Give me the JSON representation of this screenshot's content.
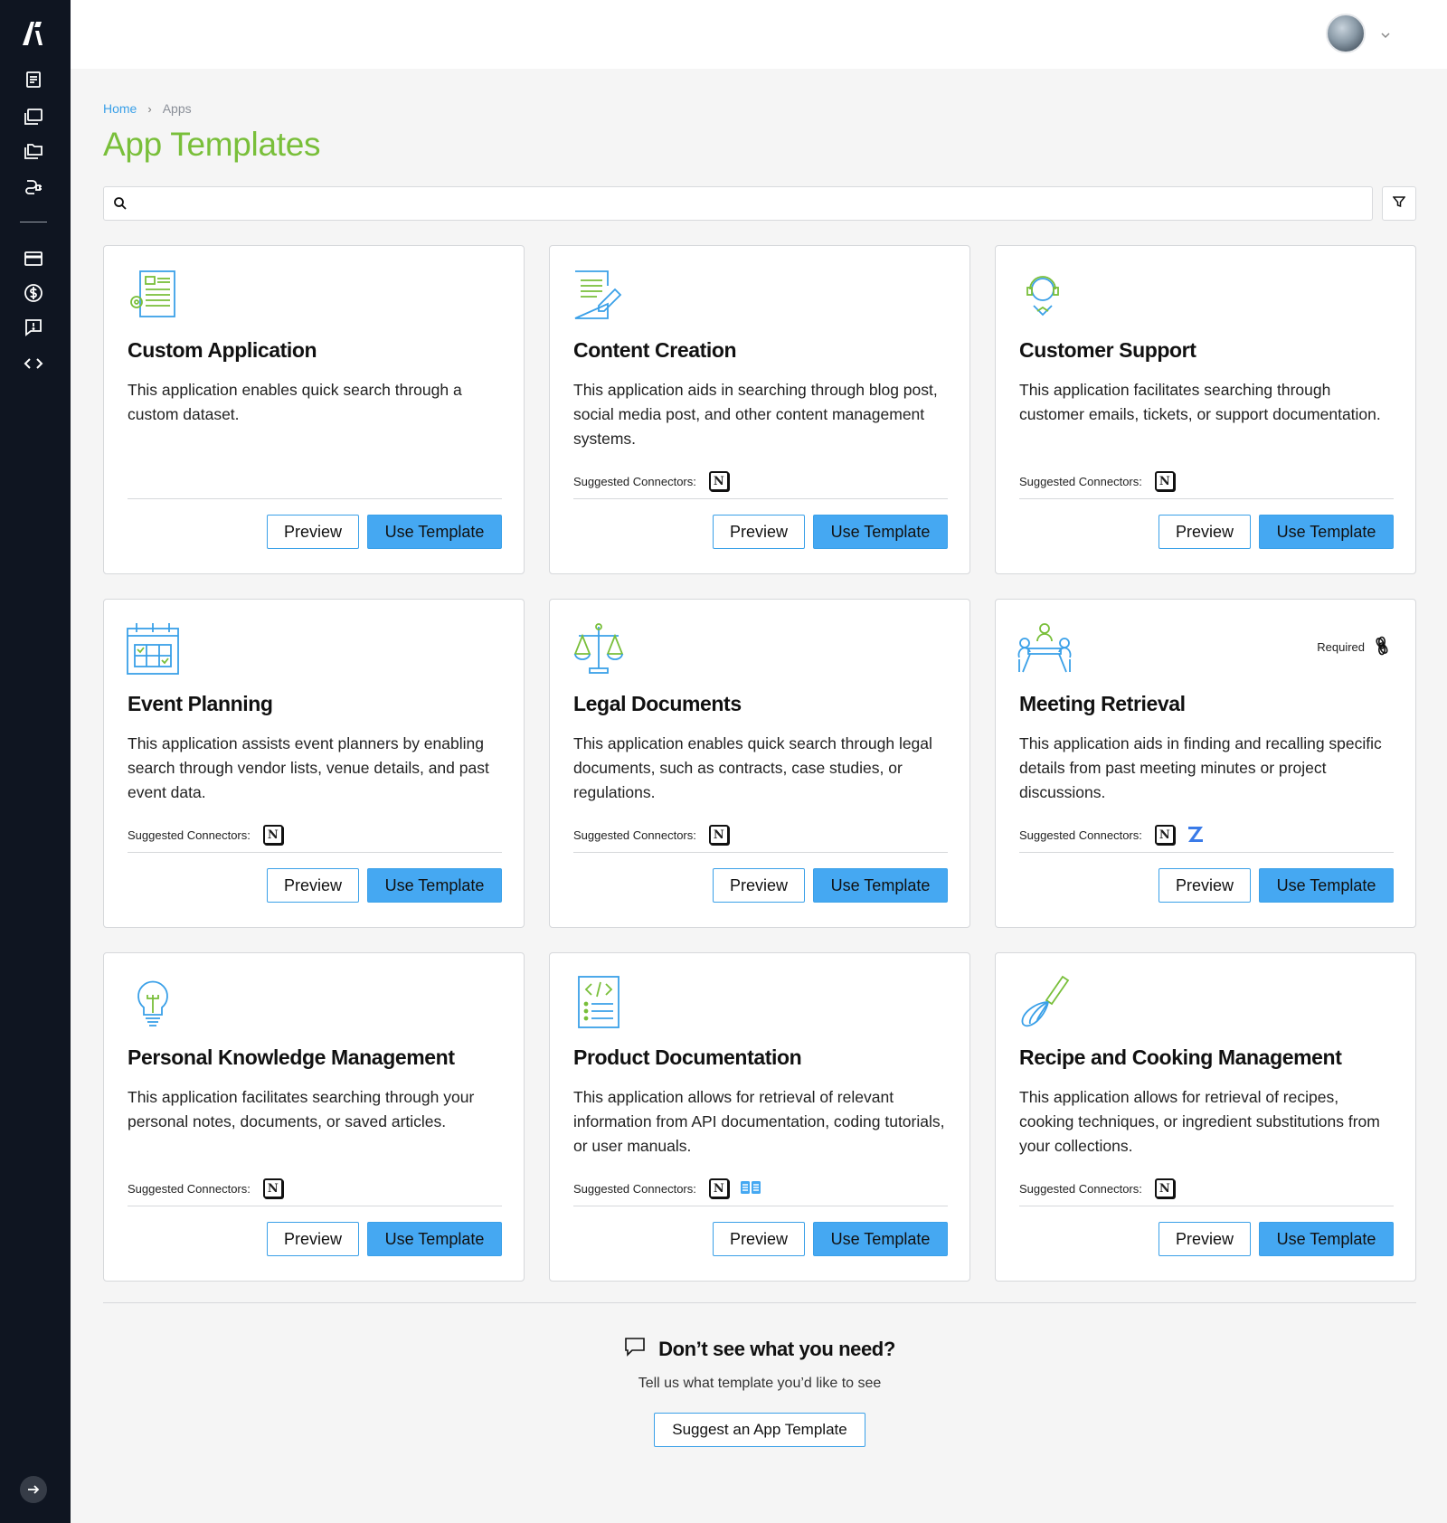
{
  "sidebar": {
    "logo": "logo-icon",
    "items": [
      {
        "icon": "document-icon"
      },
      {
        "icon": "folder-icon"
      },
      {
        "icon": "folders-icon"
      },
      {
        "icon": "connector-icon"
      },
      {
        "icon": "credit-card-icon"
      },
      {
        "icon": "dollar-icon"
      },
      {
        "icon": "feedback-icon"
      },
      {
        "icon": "code-icon"
      }
    ],
    "bottom_icon": "arrow-right-icon"
  },
  "header": {
    "avatar": "user-avatar"
  },
  "breadcrumb": {
    "home": "Home",
    "separator": "›",
    "current": "Apps"
  },
  "page": {
    "title": "App Templates"
  },
  "search": {
    "placeholder": "",
    "value": ""
  },
  "connectors_label": "Suggested Connectors:",
  "buttons": {
    "preview": "Preview",
    "use": "Use Template"
  },
  "templates": [
    {
      "title": "Custom Application",
      "description": "This application enables quick search through a custom dataset.",
      "icon": "form-gear-icon",
      "connectors": []
    },
    {
      "title": "Content Creation",
      "description": "This application aids in searching through blog post, social media post, and other content management systems.",
      "icon": "document-pen-icon",
      "connectors": [
        "notion"
      ]
    },
    {
      "title": "Customer Support",
      "description": "This application facilitates searching through customer emails, tickets, or support documentation.",
      "icon": "headset-agent-icon",
      "connectors": [
        "notion"
      ]
    },
    {
      "title": "Event Planning",
      "description": "This application assists event planners by enabling search through vendor lists, venue details, and past event data.",
      "icon": "calendar-icon",
      "connectors": [
        "notion"
      ]
    },
    {
      "title": "Legal Documents",
      "description": "This application enables quick search through legal documents, such as contracts, case studies, or regulations.",
      "icon": "scales-icon",
      "connectors": [
        "notion"
      ]
    },
    {
      "title": "Meeting Retrieval",
      "description": "This application aids in finding and recalling specific details from past meeting minutes or project discussions.",
      "icon": "meeting-icon",
      "connectors": [
        "notion",
        "zendesk"
      ],
      "required": "Required"
    },
    {
      "title": "Personal Knowledge Management",
      "description": "This application facilitates searching through your personal notes, documents, or saved articles.",
      "icon": "lightbulb-icon",
      "connectors": [
        "notion"
      ]
    },
    {
      "title": "Product Documentation",
      "description": "This application allows for retrieval of relevant information from API documentation, coding tutorials, or user manuals.",
      "icon": "code-doc-icon",
      "connectors": [
        "notion",
        "confluence"
      ]
    },
    {
      "title": "Recipe and Cooking Management",
      "description": "This application allows for retrieval of recipes, cooking techniques, or ingredient substitutions from your collections.",
      "icon": "whisk-icon",
      "connectors": [
        "notion"
      ]
    }
  ],
  "footer": {
    "title": "Don’t see what you need?",
    "subtitle": "Tell us what template you’d like to see",
    "button": "Suggest an App Template"
  },
  "colors": {
    "accent_blue": "#45a8f2",
    "title_green": "#79bf3a",
    "sidebar_bg": "#0f1521"
  }
}
